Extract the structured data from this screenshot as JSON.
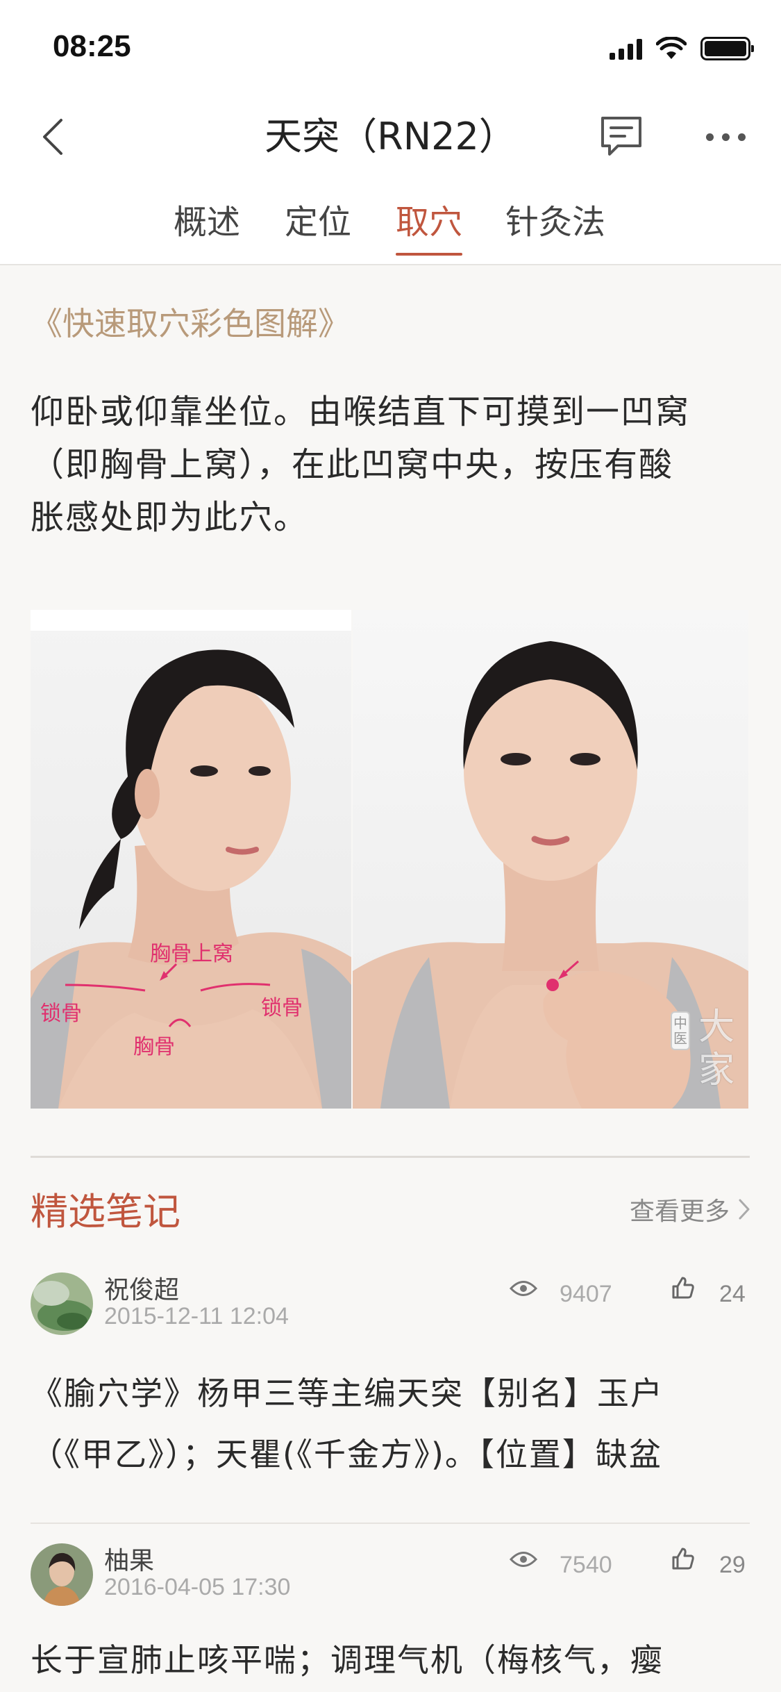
{
  "status": {
    "time": "08:25"
  },
  "header": {
    "title": "天突（RN22）",
    "back_icon": "chevron-left-icon",
    "comment_icon": "comment-icon",
    "more_icon": "more-horizontal-icon"
  },
  "tabs": [
    {
      "label": "概述"
    },
    {
      "label": "定位"
    },
    {
      "label": "取穴"
    },
    {
      "label": "针灸法"
    }
  ],
  "active_tab": "取穴",
  "content": {
    "source": "《快速取穴彩色图解》",
    "description_lines": [
      "仰卧或仰靠坐位。由喉结直下可摸到一凹窝",
      "（即胸骨上窝），在此凹窝中央，按压有酸",
      "胀感处即为此穴。"
    ],
    "image_labels": {
      "suprasternal": "胸骨上窝",
      "clavicle_left": "锁骨",
      "clavicle_right": "锁骨",
      "sternum": "胸骨",
      "watermark_small": "中医",
      "watermark_big": "大家"
    }
  },
  "notes_section": {
    "title": "精选笔记",
    "see_more": "查看更多",
    "notes": [
      {
        "author": "祝俊超",
        "date": "2015-12-11 12:04",
        "views": "9407",
        "likes": "24",
        "text_lines": [
          "《腧穴学》杨甲三等主编天突【别名】玉户",
          "（《甲乙》）；天瞿(《千金方》)。【位置】缺盆"
        ]
      },
      {
        "author": "柚果",
        "date": "2016-04-05 17:30",
        "views": "7540",
        "likes": "29",
        "text_lines": [
          "长于宣肺止咳平喘；调理气机（梅核气，瘿"
        ]
      }
    ]
  },
  "colors": {
    "accent": "#c0563e",
    "source_text": "#b89a7a",
    "label_pink": "#e0306e",
    "background": "#f8f7f5"
  }
}
